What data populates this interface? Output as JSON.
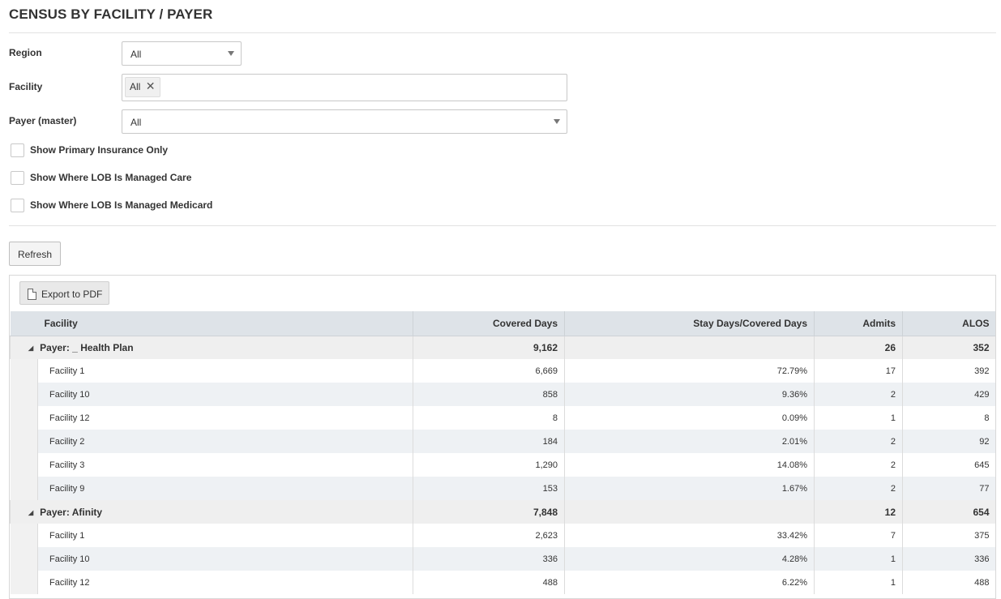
{
  "page": {
    "title": "CENSUS BY FACILITY / PAYER"
  },
  "filters": {
    "region": {
      "label": "Region",
      "value": "All"
    },
    "facility": {
      "label": "Facility",
      "tag": "All",
      "remove_glyph": "✕"
    },
    "payer": {
      "label": "Payer (master)",
      "value": "All"
    },
    "checkboxes": [
      {
        "label": "Show Primary Insurance Only",
        "checked": false
      },
      {
        "label": "Show Where LOB Is Managed Care",
        "checked": false
      },
      {
        "label": "Show Where LOB Is Managed Medicard",
        "checked": false
      }
    ]
  },
  "actions": {
    "refresh_label": "Refresh",
    "export_label": "Export to PDF",
    "export_icon": "pdf-file-icon"
  },
  "table": {
    "columns": [
      "Facility",
      "Covered Days",
      "Stay Days/Covered Days",
      "Admits",
      "ALOS"
    ],
    "collapse_glyph": "◢",
    "groups": [
      {
        "name": "Payer: _ Health Plan",
        "covered_days": "9,162",
        "ratio": "",
        "admits": "26",
        "alos": "352",
        "rows": [
          {
            "facility": "Facility 1",
            "covered_days": "6,669",
            "ratio": "72.79%",
            "admits": "17",
            "alos": "392"
          },
          {
            "facility": "Facility 10",
            "covered_days": "858",
            "ratio": "9.36%",
            "admits": "2",
            "alos": "429"
          },
          {
            "facility": "Facility 12",
            "covered_days": "8",
            "ratio": "0.09%",
            "admits": "1",
            "alos": "8"
          },
          {
            "facility": "Facility 2",
            "covered_days": "184",
            "ratio": "2.01%",
            "admits": "2",
            "alos": "92"
          },
          {
            "facility": "Facility 3",
            "covered_days": "1,290",
            "ratio": "14.08%",
            "admits": "2",
            "alos": "645"
          },
          {
            "facility": "Facility 9",
            "covered_days": "153",
            "ratio": "1.67%",
            "admits": "2",
            "alos": "77"
          }
        ]
      },
      {
        "name": "Payer: Afinity",
        "covered_days": "7,848",
        "ratio": "",
        "admits": "12",
        "alos": "654",
        "rows": [
          {
            "facility": "Facility 1",
            "covered_days": "2,623",
            "ratio": "33.42%",
            "admits": "7",
            "alos": "375"
          },
          {
            "facility": "Facility 10",
            "covered_days": "336",
            "ratio": "4.28%",
            "admits": "1",
            "alos": "336"
          },
          {
            "facility": "Facility 12",
            "covered_days": "488",
            "ratio": "6.22%",
            "admits": "1",
            "alos": "488"
          }
        ]
      }
    ]
  }
}
